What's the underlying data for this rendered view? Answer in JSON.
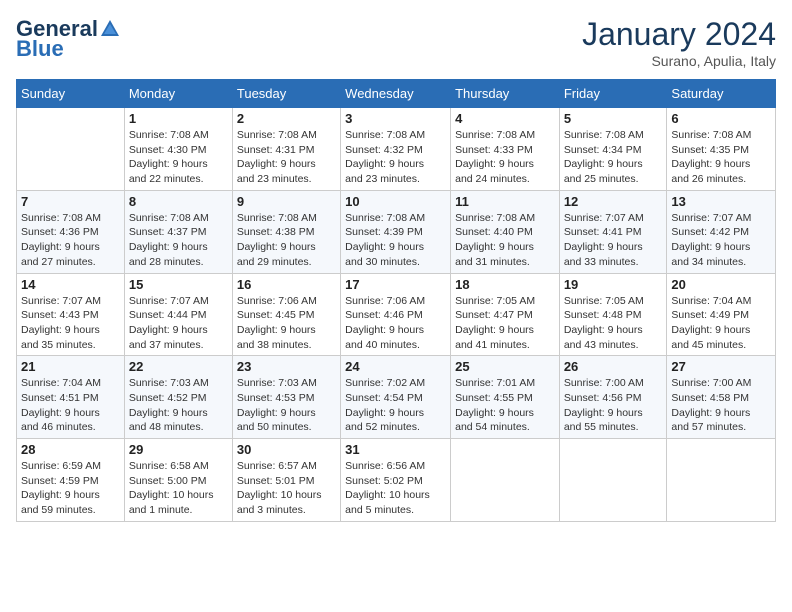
{
  "logo": {
    "text_general": "General",
    "text_blue": "Blue"
  },
  "header": {
    "month": "January 2024",
    "location": "Surano, Apulia, Italy"
  },
  "weekdays": [
    "Sunday",
    "Monday",
    "Tuesday",
    "Wednesday",
    "Thursday",
    "Friday",
    "Saturday"
  ],
  "weeks": [
    [
      {
        "day": "",
        "info": ""
      },
      {
        "day": "1",
        "info": "Sunrise: 7:08 AM\nSunset: 4:30 PM\nDaylight: 9 hours\nand 22 minutes."
      },
      {
        "day": "2",
        "info": "Sunrise: 7:08 AM\nSunset: 4:31 PM\nDaylight: 9 hours\nand 23 minutes."
      },
      {
        "day": "3",
        "info": "Sunrise: 7:08 AM\nSunset: 4:32 PM\nDaylight: 9 hours\nand 23 minutes."
      },
      {
        "day": "4",
        "info": "Sunrise: 7:08 AM\nSunset: 4:33 PM\nDaylight: 9 hours\nand 24 minutes."
      },
      {
        "day": "5",
        "info": "Sunrise: 7:08 AM\nSunset: 4:34 PM\nDaylight: 9 hours\nand 25 minutes."
      },
      {
        "day": "6",
        "info": "Sunrise: 7:08 AM\nSunset: 4:35 PM\nDaylight: 9 hours\nand 26 minutes."
      }
    ],
    [
      {
        "day": "7",
        "info": "Sunrise: 7:08 AM\nSunset: 4:36 PM\nDaylight: 9 hours\nand 27 minutes."
      },
      {
        "day": "8",
        "info": "Sunrise: 7:08 AM\nSunset: 4:37 PM\nDaylight: 9 hours\nand 28 minutes."
      },
      {
        "day": "9",
        "info": "Sunrise: 7:08 AM\nSunset: 4:38 PM\nDaylight: 9 hours\nand 29 minutes."
      },
      {
        "day": "10",
        "info": "Sunrise: 7:08 AM\nSunset: 4:39 PM\nDaylight: 9 hours\nand 30 minutes."
      },
      {
        "day": "11",
        "info": "Sunrise: 7:08 AM\nSunset: 4:40 PM\nDaylight: 9 hours\nand 31 minutes."
      },
      {
        "day": "12",
        "info": "Sunrise: 7:07 AM\nSunset: 4:41 PM\nDaylight: 9 hours\nand 33 minutes."
      },
      {
        "day": "13",
        "info": "Sunrise: 7:07 AM\nSunset: 4:42 PM\nDaylight: 9 hours\nand 34 minutes."
      }
    ],
    [
      {
        "day": "14",
        "info": "Sunrise: 7:07 AM\nSunset: 4:43 PM\nDaylight: 9 hours\nand 35 minutes."
      },
      {
        "day": "15",
        "info": "Sunrise: 7:07 AM\nSunset: 4:44 PM\nDaylight: 9 hours\nand 37 minutes."
      },
      {
        "day": "16",
        "info": "Sunrise: 7:06 AM\nSunset: 4:45 PM\nDaylight: 9 hours\nand 38 minutes."
      },
      {
        "day": "17",
        "info": "Sunrise: 7:06 AM\nSunset: 4:46 PM\nDaylight: 9 hours\nand 40 minutes."
      },
      {
        "day": "18",
        "info": "Sunrise: 7:05 AM\nSunset: 4:47 PM\nDaylight: 9 hours\nand 41 minutes."
      },
      {
        "day": "19",
        "info": "Sunrise: 7:05 AM\nSunset: 4:48 PM\nDaylight: 9 hours\nand 43 minutes."
      },
      {
        "day": "20",
        "info": "Sunrise: 7:04 AM\nSunset: 4:49 PM\nDaylight: 9 hours\nand 45 minutes."
      }
    ],
    [
      {
        "day": "21",
        "info": "Sunrise: 7:04 AM\nSunset: 4:51 PM\nDaylight: 9 hours\nand 46 minutes."
      },
      {
        "day": "22",
        "info": "Sunrise: 7:03 AM\nSunset: 4:52 PM\nDaylight: 9 hours\nand 48 minutes."
      },
      {
        "day": "23",
        "info": "Sunrise: 7:03 AM\nSunset: 4:53 PM\nDaylight: 9 hours\nand 50 minutes."
      },
      {
        "day": "24",
        "info": "Sunrise: 7:02 AM\nSunset: 4:54 PM\nDaylight: 9 hours\nand 52 minutes."
      },
      {
        "day": "25",
        "info": "Sunrise: 7:01 AM\nSunset: 4:55 PM\nDaylight: 9 hours\nand 54 minutes."
      },
      {
        "day": "26",
        "info": "Sunrise: 7:00 AM\nSunset: 4:56 PM\nDaylight: 9 hours\nand 55 minutes."
      },
      {
        "day": "27",
        "info": "Sunrise: 7:00 AM\nSunset: 4:58 PM\nDaylight: 9 hours\nand 57 minutes."
      }
    ],
    [
      {
        "day": "28",
        "info": "Sunrise: 6:59 AM\nSunset: 4:59 PM\nDaylight: 9 hours\nand 59 minutes."
      },
      {
        "day": "29",
        "info": "Sunrise: 6:58 AM\nSunset: 5:00 PM\nDaylight: 10 hours\nand 1 minute."
      },
      {
        "day": "30",
        "info": "Sunrise: 6:57 AM\nSunset: 5:01 PM\nDaylight: 10 hours\nand 3 minutes."
      },
      {
        "day": "31",
        "info": "Sunrise: 6:56 AM\nSunset: 5:02 PM\nDaylight: 10 hours\nand 5 minutes."
      },
      {
        "day": "",
        "info": ""
      },
      {
        "day": "",
        "info": ""
      },
      {
        "day": "",
        "info": ""
      }
    ]
  ]
}
